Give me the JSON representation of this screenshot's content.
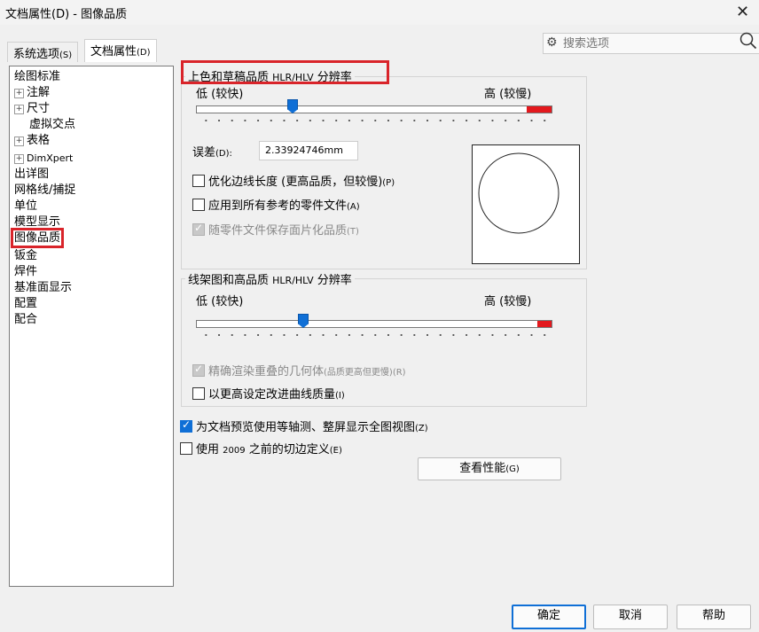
{
  "window": {
    "title": "文档属性(D) - 图像品质",
    "close_glyph": "✕"
  },
  "tabs": {
    "system": "系统选项",
    "system_key": "(S)",
    "document": "文档属性",
    "document_key": "(D)"
  },
  "search": {
    "placeholder": "搜索选项",
    "gear_glyph": "⚙",
    "mag_glyph": "⚲"
  },
  "tree": {
    "items": [
      {
        "label": "绘图标准"
      },
      {
        "label": "注解",
        "expander": "+"
      },
      {
        "label": "尺寸",
        "expander": "+"
      },
      {
        "label": "虚拟交点"
      },
      {
        "label": "表格",
        "expander": "+"
      },
      {
        "label": "DimXpert",
        "expander": "+"
      },
      {
        "label": "出详图"
      },
      {
        "label": "网格线/捕捉"
      },
      {
        "label": "单位"
      },
      {
        "label": "模型显示"
      },
      {
        "label": "图像品质",
        "selected": true
      },
      {
        "label": "钣金"
      },
      {
        "label": "焊件"
      },
      {
        "label": "基准面显示"
      },
      {
        "label": "配置"
      },
      {
        "label": "配合"
      }
    ]
  },
  "shaded": {
    "title": "上色和草稿品质",
    "title_suffix": "HLR/HLV",
    "title_tail": "分辨率",
    "low_label": "低 (较快)",
    "high_label": "高 (较慢)",
    "slider_fraction": 0.27,
    "tolerance_label": "误差",
    "tolerance_key": "(D):",
    "tolerance_value": "2.33924746mm",
    "opt_edge_label": "优化边线长度 (更高品质，但较慢)",
    "opt_edge_key": "(P)",
    "opt_edge_checked": false,
    "apply_all_label": "应用到所有参考的零件文件",
    "apply_all_key": "(A)",
    "apply_all_checked": false,
    "save_tess_label": "随零件文件保存面片化品质",
    "save_tess_key": "(T)",
    "save_tess_checked": true
  },
  "wireframe": {
    "title": "线架图和高品质",
    "title_suffix": "HLR/HLV",
    "title_tail": "分辨率",
    "low_label": "低 (较快)",
    "high_label": "高 (较慢)",
    "slider_fraction": 0.3,
    "precise_label": "精确渲染重叠的几何体",
    "precise_small": "(品质更高但更慢)",
    "precise_key": "(R)",
    "precise_checked": true,
    "curve_label": "以更高设定改进曲线质量",
    "curve_key": "(I)",
    "curve_checked": false
  },
  "options": {
    "iso_label": "为文档预览使用等轴测、整屏显示全图视图",
    "iso_key": "(Z)",
    "iso_checked": true,
    "pre2009_label": "使用",
    "pre2009_year": "2009",
    "pre2009_tail": "之前的切边定义",
    "pre2009_key": "(E)",
    "pre2009_checked": false
  },
  "buttons": {
    "perf": "查看性能",
    "perf_key": "(G)",
    "ok": "确定",
    "cancel": "取消",
    "help": "帮助"
  },
  "colors": {
    "accent": "#0f6fd6",
    "highlight": "#d9242a",
    "slider_red": "#e3181d"
  }
}
